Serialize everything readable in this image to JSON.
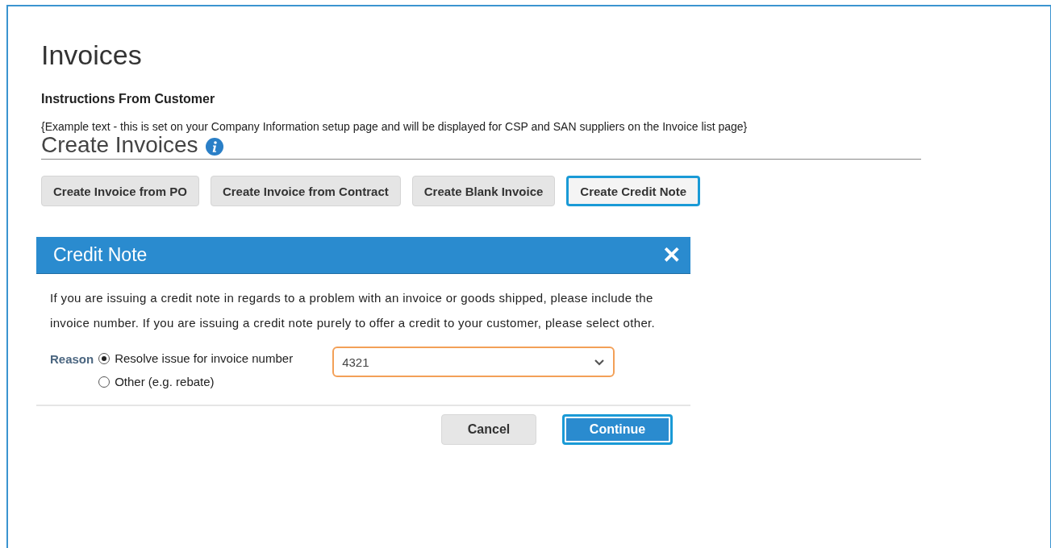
{
  "page_title": "Invoices",
  "instructions": {
    "heading": "Instructions From Customer",
    "text": "{Example text - this is set on your Company Information setup page and will be displayed for CSP and SAN suppliers on the Invoice list page}"
  },
  "section_title": "Create Invoices",
  "buttons": [
    {
      "label": "Create Invoice from PO",
      "highlighted": false
    },
    {
      "label": "Create Invoice from Contract",
      "highlighted": false
    },
    {
      "label": "Create Blank Invoice",
      "highlighted": false
    },
    {
      "label": "Create Credit Note",
      "highlighted": true
    }
  ],
  "dialog": {
    "title": "Credit Note",
    "close": "✕",
    "message": "If you are issuing a credit note in regards to a problem with an invoice or goods shipped, please include the invoice number. If you are issuing a credit note purely to offer a credit to your customer, please select other.",
    "reason_label": "Reason",
    "options": [
      {
        "label": "Resolve issue for invoice number",
        "selected": true
      },
      {
        "label": "Other (e.g. rebate)",
        "selected": false
      }
    ],
    "invoice_number": "4321",
    "actions": [
      {
        "label": "Cancel",
        "kind": "secondary",
        "highlighted": false
      },
      {
        "label": "Continue",
        "kind": "primary",
        "highlighted": true
      }
    ]
  }
}
